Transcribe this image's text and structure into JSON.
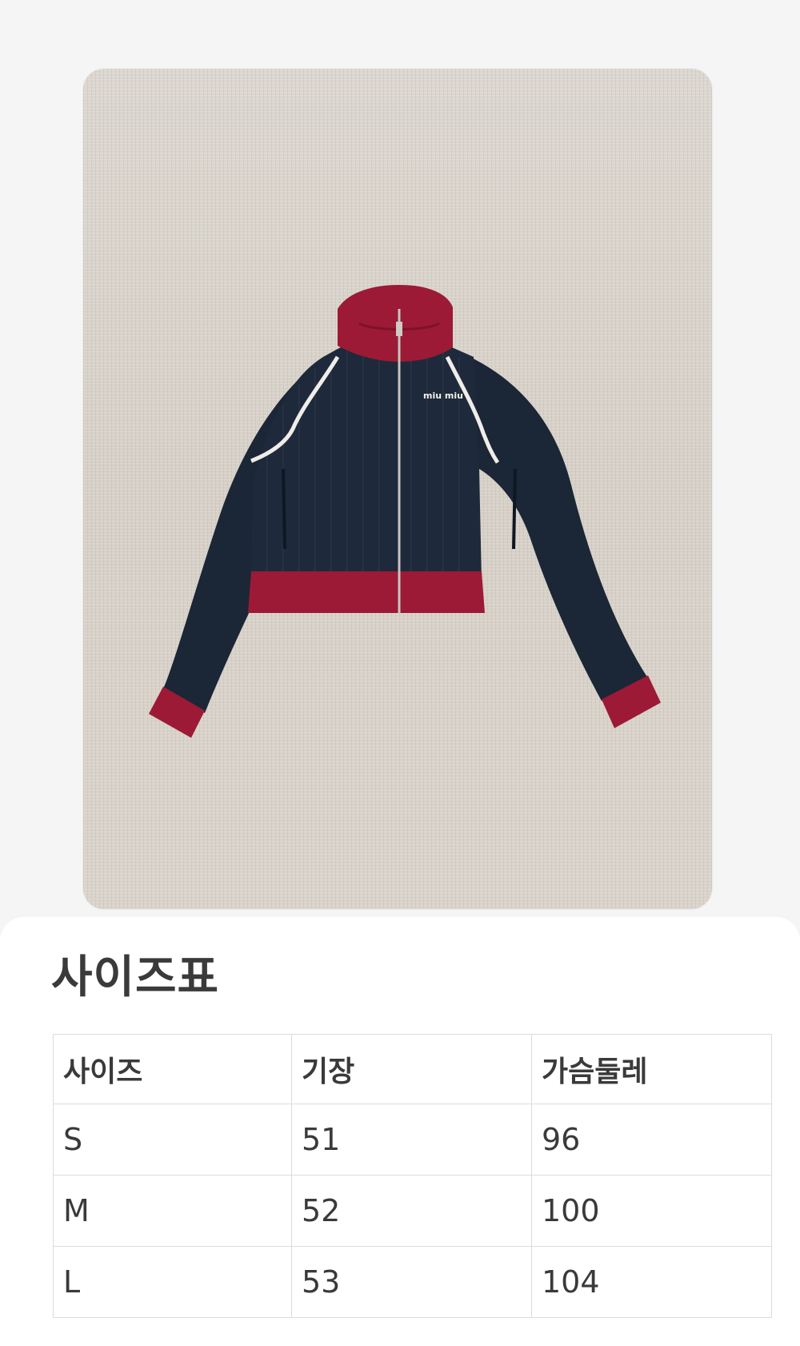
{
  "product_image": {
    "subject": "jacket-photo",
    "logo_text": "miu miu",
    "colors": {
      "body": "#1b2636",
      "trim": "#9c1a35",
      "piping": "#f0ede8",
      "background": "#d8d2ca"
    }
  },
  "size_chart": {
    "title": "사이즈표",
    "headers": [
      "사이즈",
      "기장",
      "가슴둘레"
    ],
    "rows": [
      [
        "S",
        "51",
        "96"
      ],
      [
        "M",
        "52",
        "100"
      ],
      [
        "L",
        "53",
        "104"
      ]
    ]
  }
}
